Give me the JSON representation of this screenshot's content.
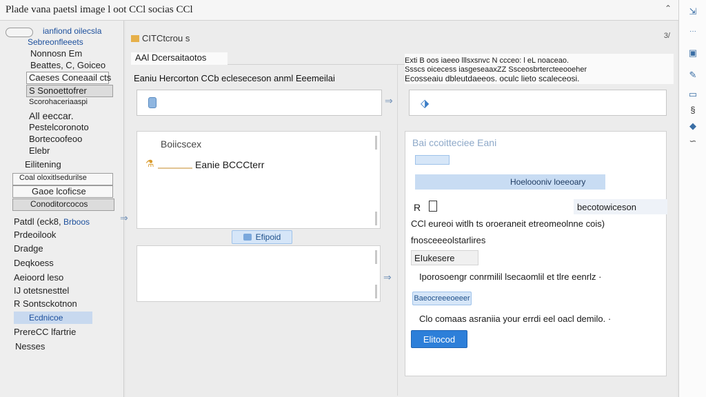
{
  "window": {
    "title": "Plade vana paetsl image  l  oot CCl  socias  CCl",
    "control": "⌃"
  },
  "sidebar": {
    "items": [
      {
        "label": "ianfiond oilecsla"
      },
      {
        "label": "Sebreonfleeets"
      },
      {
        "label": "Nonnosn Em"
      },
      {
        "label": "Beattes, C, Goiceo"
      },
      {
        "label": "Caeses  Coneaail  cts"
      },
      {
        "label": "S Sonoettofrer"
      },
      {
        "label": "Scorohaceriaaspi"
      },
      {
        "label": "All eeccar."
      },
      {
        "label": "Pestelcoronoto"
      },
      {
        "label": "Bortecoofeoo"
      },
      {
        "label": "Elebr"
      },
      {
        "label": "Eilitening"
      },
      {
        "label": "Coal oloxitlsedurilse"
      },
      {
        "label": "Gaoe lcoficse"
      },
      {
        "label": "Conoditorcocos"
      },
      {
        "label": "Patdl (eck8,"
      },
      {
        "label": "Brboos"
      },
      {
        "label": "Prdeoilook"
      },
      {
        "label": "Dradge"
      },
      {
        "label": "Deqkoess"
      },
      {
        "label": "Aeioord leso"
      },
      {
        "label": "IJ otetsnesttel"
      },
      {
        "label": "R Sontsckotnon"
      },
      {
        "label": "Ecdnicoe"
      },
      {
        "label": "PrereCC lfartrie"
      },
      {
        "label": "Nesses"
      }
    ]
  },
  "main": {
    "breadcrumb": "CITCtcrou  s",
    "crumb_end": "3/",
    "tab": "AAl Dcersaitaotos",
    "left": {
      "heading": "Eaniu Hercorton CCb  ecleseceson anml Eeemeilai",
      "panel_title": "Boiicscex",
      "attachment": "Eanie BCCCterr",
      "attach_button": "Efipoid"
    },
    "right": {
      "heading_1": "Exti  B oos  iaeeo  lllsxsnvc  N  ccceo:  l eL  noaceao.",
      "heading_2": "Ssscs oicecess iasgeseaaxZZ  Ssceosbrtercteeooeher",
      "heading_3": "Ecosseaiu  dbleutdaeeos.  oculc lieto scaleceosi.",
      "panel_title": "Bai ccoitteciee Eani",
      "hl_bar_label": "Hoeloooniv loeeoary",
      "row_r": "R",
      "row_r_value": "becotowiceson",
      "line_1": "CCl  eureoi witlh ts oroeraneit etreomeolnne cois)",
      "line_2": "fnosceeeolstarlires",
      "box_label": "EIukesere",
      "line_3": "Iporosoengr conrmilil lsecaomlil et tlre eenrlz  ·",
      "small_btn": "Baeocreeeoeeer",
      "line_4": "Clo comaas asraniia your errdi eel oacl  demilo.  ·",
      "primary_btn": "Elitocod"
    }
  }
}
